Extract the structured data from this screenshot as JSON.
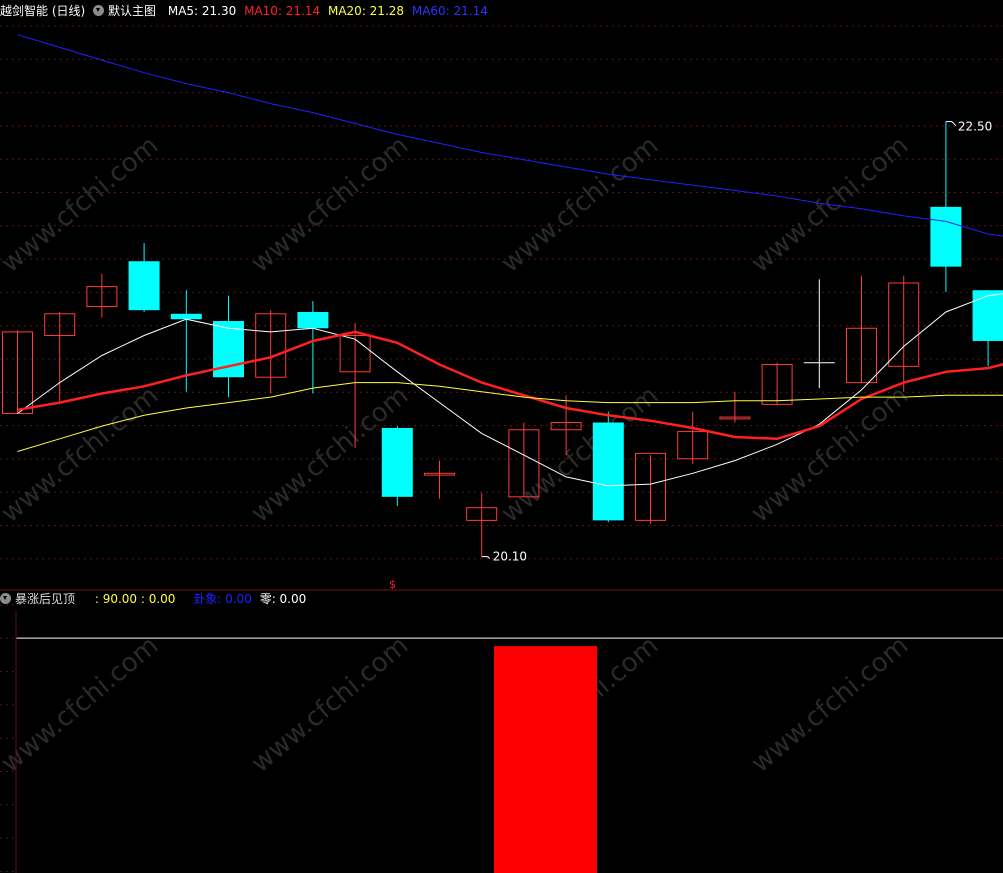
{
  "main_header": {
    "title": "越剑智能 (日线)",
    "template_label": "默认主图",
    "ma_items": [
      {
        "label": "MA5: 21.30",
        "color": "#ffffff"
      },
      {
        "label": "MA10: 21.14",
        "color": "#ff2020"
      },
      {
        "label": "MA20: 21.28",
        "color": "#ffff40"
      },
      {
        "label": "MA60: 21.14",
        "color": "#2020ff"
      }
    ]
  },
  "sub_header": {
    "indicator_name": "暴涨后见顶",
    "values_label": ": 90.00 : 0.00",
    "signal_label": "卦象: 0.00",
    "zero_label": "零: 0.00"
  },
  "price_annotations": {
    "high_label": "22.50",
    "low_label": "20.10",
    "marker_label": "$"
  },
  "watermark_text": "www.cfchi.com",
  "chart_data": {
    "type": "candlestick",
    "price_range": [
      19.96,
      23.05
    ],
    "candles": [
      {
        "o": 20.89,
        "h": 21.35,
        "l": 20.89,
        "c": 21.34,
        "color": "red"
      },
      {
        "o": 21.32,
        "h": 21.45,
        "l": 20.94,
        "c": 21.44,
        "color": "red"
      },
      {
        "o": 21.48,
        "h": 21.66,
        "l": 21.42,
        "c": 21.59,
        "color": "red"
      },
      {
        "o": 21.73,
        "h": 21.83,
        "l": 21.45,
        "c": 21.46,
        "color": "cyan"
      },
      {
        "o": 21.44,
        "h": 21.57,
        "l": 21.01,
        "c": 21.41,
        "color": "cyan"
      },
      {
        "o": 21.4,
        "h": 21.54,
        "l": 20.98,
        "c": 21.09,
        "color": "cyan"
      },
      {
        "o": 21.09,
        "h": 21.46,
        "l": 21.0,
        "c": 21.44,
        "color": "red"
      },
      {
        "o": 21.45,
        "h": 21.51,
        "l": 21.0,
        "c": 21.36,
        "color": "cyan"
      },
      {
        "o": 21.12,
        "h": 21.39,
        "l": 20.7,
        "c": 21.32,
        "color": "red"
      },
      {
        "o": 20.81,
        "h": 20.82,
        "l": 20.38,
        "c": 20.43,
        "color": "cyan"
      },
      {
        "o": 20.55,
        "h": 20.63,
        "l": 20.42,
        "c": 20.56,
        "color": "red"
      },
      {
        "o": 20.3,
        "h": 20.45,
        "l": 20.1,
        "c": 20.37,
        "color": "red"
      },
      {
        "o": 20.43,
        "h": 20.84,
        "l": 20.43,
        "c": 20.8,
        "color": "red"
      },
      {
        "o": 20.8,
        "h": 20.99,
        "l": 20.66,
        "c": 20.84,
        "color": "red"
      },
      {
        "o": 20.84,
        "h": 20.9,
        "l": 20.29,
        "c": 20.3,
        "color": "cyan"
      },
      {
        "o": 20.3,
        "h": 20.66,
        "l": 20.28,
        "c": 20.67,
        "color": "red"
      },
      {
        "o": 20.64,
        "h": 20.9,
        "l": 20.61,
        "c": 20.79,
        "color": "red"
      },
      {
        "o": 20.86,
        "h": 21.01,
        "l": 20.84,
        "c": 20.87,
        "color": "red"
      },
      {
        "o": 20.94,
        "h": 21.17,
        "l": 20.94,
        "c": 21.16,
        "color": "red"
      },
      {
        "o": 21.16,
        "h": 21.63,
        "l": 21.03,
        "c": 21.17,
        "color": "white"
      },
      {
        "o": 21.06,
        "h": 21.65,
        "l": 21.06,
        "c": 21.36,
        "color": "red"
      },
      {
        "o": 21.15,
        "h": 21.65,
        "l": 21.01,
        "c": 21.61,
        "color": "red"
      },
      {
        "o": 22.03,
        "h": 22.5,
        "l": 21.56,
        "c": 21.7,
        "color": "cyan"
      },
      {
        "o": 21.57,
        "h": 21.57,
        "l": 21.15,
        "c": 21.29,
        "color": "cyan"
      }
    ],
    "series": [
      {
        "name": "MA5",
        "color": "#ffffff",
        "values": [
          20.89,
          21.06,
          21.21,
          21.32,
          21.41,
          21.36,
          21.34,
          21.36,
          21.3,
          21.12,
          20.95,
          20.78,
          20.66,
          20.54,
          20.49,
          20.5,
          20.56,
          20.63,
          20.72,
          20.83,
          21.02,
          21.26,
          21.45,
          21.54,
          21.57
        ]
      },
      {
        "name": "MA10",
        "color": "#ff2020",
        "values": [
          20.91,
          20.95,
          21.0,
          21.04,
          21.1,
          21.15,
          21.2,
          21.29,
          21.34,
          21.28,
          21.16,
          21.06,
          20.99,
          20.92,
          20.88,
          20.85,
          20.81,
          20.76,
          20.75,
          20.82,
          20.97,
          21.06,
          21.12,
          21.14,
          21.2
        ]
      },
      {
        "name": "MA20",
        "color": "#ffff40",
        "values": [
          20.68,
          20.75,
          20.82,
          20.88,
          20.92,
          20.95,
          20.98,
          21.03,
          21.06,
          21.06,
          21.04,
          21.01,
          20.98,
          20.96,
          20.95,
          20.95,
          20.95,
          20.96,
          20.96,
          20.97,
          20.98,
          20.98,
          20.99,
          20.99,
          20.99
        ]
      },
      {
        "name": "MA60",
        "color": "#2020ff",
        "values": [
          22.98,
          22.91,
          22.84,
          22.77,
          22.71,
          22.66,
          22.6,
          22.55,
          22.49,
          22.43,
          22.38,
          22.33,
          22.29,
          22.25,
          22.21,
          22.18,
          22.15,
          22.12,
          22.09,
          22.05,
          22.02,
          21.98,
          21.95,
          21.88,
          21.85
        ]
      }
    ],
    "indicator": {
      "line_level": 90.0,
      "bar_candle_index": 12,
      "bar_value": 90.0,
      "bar_color": "#ff0000",
      "line_color": "#ffffff"
    }
  }
}
